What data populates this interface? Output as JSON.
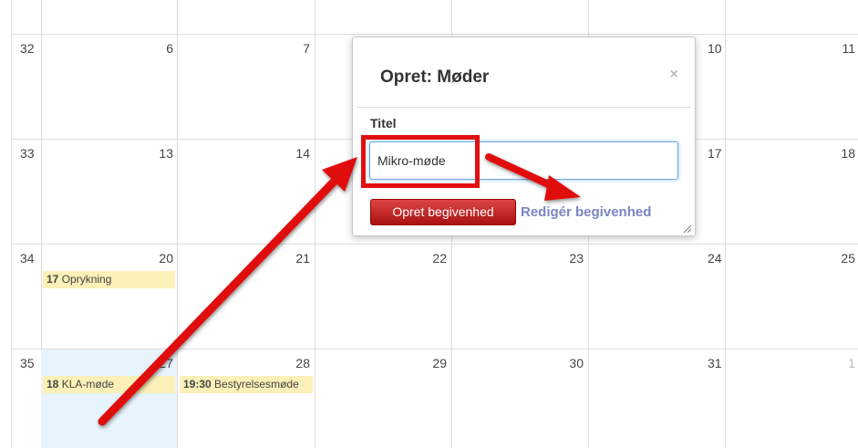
{
  "weeks": [
    {
      "week": "32",
      "days": [
        "6",
        "7",
        "",
        "",
        "10",
        "11"
      ]
    },
    {
      "week": "33",
      "days": [
        "13",
        "14",
        "",
        "",
        "17",
        "18"
      ]
    },
    {
      "week": "34",
      "days": [
        "20",
        "21",
        "22",
        "23",
        "24",
        "25"
      ]
    },
    {
      "week": "35",
      "days": [
        "27",
        "28",
        "29",
        "30",
        "31",
        "1"
      ]
    }
  ],
  "events": {
    "oprykning": {
      "time": "17",
      "title": "Oprykning"
    },
    "kla": {
      "time": "18",
      "title": "KLA-møde"
    },
    "bestyrelse": {
      "time": "19:30",
      "title": "Bestyrelsesmøde"
    }
  },
  "popup": {
    "title": "Opret: Møder",
    "close": "×",
    "field_label": "Titel",
    "title_value": "Mikro-møde",
    "create_button": "Opret begivenhed",
    "edit_link": "Redigér begivenhed"
  },
  "colors": {
    "event_bg": "#fbf0b8",
    "today_bg": "#e8f4fb",
    "create_button": "#c22222",
    "edit_link": "#7a84c2",
    "annotation": "#e01010"
  }
}
